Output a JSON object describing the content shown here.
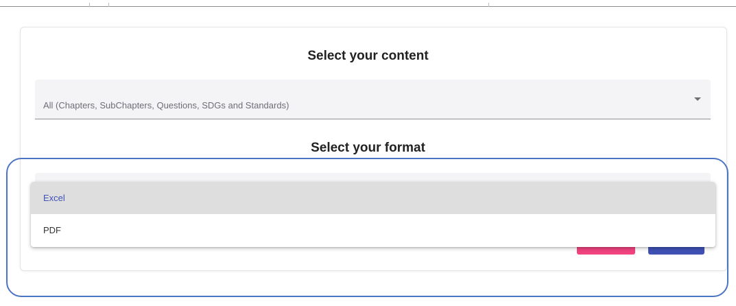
{
  "content_section": {
    "heading": "Select your content",
    "selected_value": "All (Chapters, SubChapters, Questions, SDGs and Standards)"
  },
  "format_section": {
    "heading": "Select your format",
    "options": [
      {
        "label": "Excel",
        "selected": true
      },
      {
        "label": "PDF",
        "selected": false
      }
    ]
  },
  "colors": {
    "accent": "#3f51b5",
    "cancel": "#f0437f",
    "highlight_ring": "#4b73c4"
  },
  "icons": {
    "select_arrow": "chevron-down-icon"
  }
}
